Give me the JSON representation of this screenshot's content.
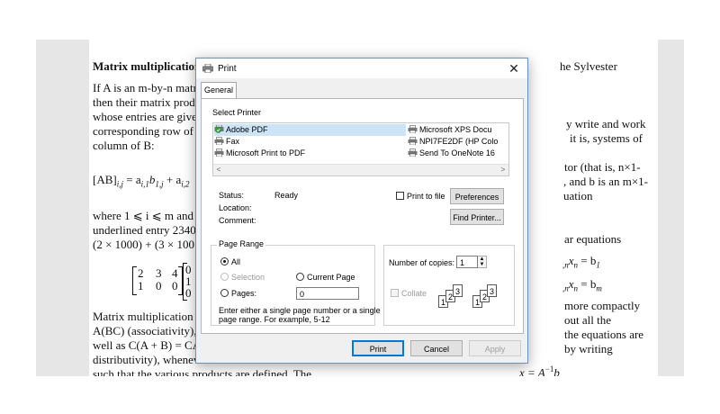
{
  "document": {
    "lines": [
      {
        "text": "Matrix multiplication",
        "bold": true
      },
      {
        "text": "he Sylvester"
      },
      {
        "text": "If A is an m-by-n matr"
      },
      {
        "text": "then their matrix produ"
      },
      {
        "text": "whose entries are give"
      },
      {
        "text": "corresponding row of ."
      },
      {
        "text": "column of B:"
      },
      {
        "text": "where 1 ⩽ i ⩽ m and"
      },
      {
        "text": "underlined entry 2340"
      },
      {
        "text": "(2 × 1000) + (3 × 100"
      },
      {
        "text": "Matrix multiplication s"
      },
      {
        "text": "A(BC) (associativity),"
      },
      {
        "text": "well as C(A + B) = CA"
      },
      {
        "text": "distributivity), whenev"
      },
      {
        "text": "such that the various products are defined. The"
      },
      {
        "text": "y write and work"
      },
      {
        "text": "it is, systems of"
      },
      {
        "text": "tor (that is, n×1-"
      },
      {
        "text": ", and b is an m×1-"
      },
      {
        "text": "uation"
      },
      {
        "text": "ar equations"
      },
      {
        "text": "more compactly"
      },
      {
        "text": "out all the"
      },
      {
        "text": "the equations are"
      },
      {
        "text": "by writing"
      }
    ],
    "formula_ab": "[AB]",
    "formula_ab_sub": "i,j",
    "formula_rhs": " = a",
    "formula_rhs2": "i,1",
    "formula_rhs3": "b",
    "formula_rhs4": "1,j",
    "formula_rhs5": " + a",
    "formula_rhs6": "i,2",
    "eq1": ",nxn = b1",
    "eq1_a": ",n",
    "eq1_x": "x",
    "eq1_n": "n",
    "eq1_eq": " = b",
    "eq1_1": "1",
    "eq2_a": ",n",
    "eq2_x": "x",
    "eq2_n": "n",
    "eq2_eq": " = b",
    "eq2_m": "m",
    "solution": "x = A",
    "solution_exp": "−1",
    "solution_b": "b",
    "matrix_left": [
      [
        "2",
        "3",
        "4"
      ],
      [
        "1",
        "0",
        "0"
      ]
    ],
    "matrix_right": [
      "0",
      "1",
      "0"
    ]
  },
  "dialog": {
    "title": "Print",
    "close": "✕",
    "tab": "General",
    "select_printer": "Select Printer",
    "printers": [
      {
        "name": "Adobe PDF",
        "selected": true
      },
      {
        "name": "Fax",
        "selected": false
      },
      {
        "name": "Microsoft Print to PDF",
        "selected": false
      },
      {
        "name": "Microsoft XPS Docu",
        "selected": false
      },
      {
        "name": "NPI7FE2DF (HP Colo",
        "selected": false
      },
      {
        "name": "Send To OneNote 16",
        "selected": false
      }
    ],
    "scroll_left": "<",
    "scroll_right": ">",
    "status_label": "Status:",
    "status_value": "Ready",
    "location_label": "Location:",
    "comment_label": "Comment:",
    "print_to_file": "Print to file",
    "preferences": "Preferences",
    "find_printer": "Find Printer...",
    "page_range": "Page Range",
    "all": "All",
    "selection": "Selection",
    "current_page": "Current Page",
    "pages": "Pages:",
    "pages_value": "0",
    "hint_line1": "Enter either a single page number or a single",
    "hint_line2": "page range.  For example, 5-12",
    "copies_label": "Number of copies:",
    "copies_value": "1",
    "collate": "Collate",
    "collate_pages": [
      "1",
      "2",
      "3",
      "1",
      "2",
      "3"
    ],
    "print_btn": "Print",
    "cancel_btn": "Cancel",
    "apply_btn": "Apply"
  }
}
